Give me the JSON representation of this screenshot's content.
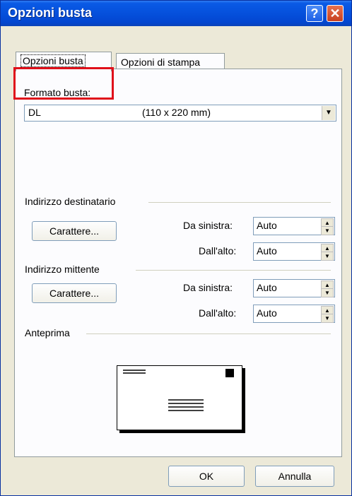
{
  "window": {
    "title": "Opzioni busta"
  },
  "titlebar_buttons": {
    "help": "?",
    "close": "✕"
  },
  "tabs": [
    {
      "label": "Opzioni busta",
      "active": true
    },
    {
      "label": "Opzioni di stampa",
      "active": false
    }
  ],
  "envelope_size": {
    "label": "Formato busta:",
    "name": "DL",
    "dimensions": "(110 x 220 mm)"
  },
  "recipient": {
    "group_label": "Indirizzo destinatario",
    "font_button": "Carattere...",
    "from_left_label": "Da sinistra:",
    "from_left_value": "Auto",
    "from_top_label": "Dall'alto:",
    "from_top_value": "Auto"
  },
  "return_address": {
    "group_label": "Indirizzo mittente",
    "font_button": "Carattere...",
    "from_left_label": "Da sinistra:",
    "from_left_value": "Auto",
    "from_top_label": "Dall'alto:",
    "from_top_value": "Auto"
  },
  "preview": {
    "group_label": "Anteprima"
  },
  "footer": {
    "ok": "OK",
    "cancel": "Annulla"
  },
  "colors": {
    "titlebar": "#0550dc",
    "highlight": "#e0101a",
    "dialog_bg": "#ece9d8"
  }
}
